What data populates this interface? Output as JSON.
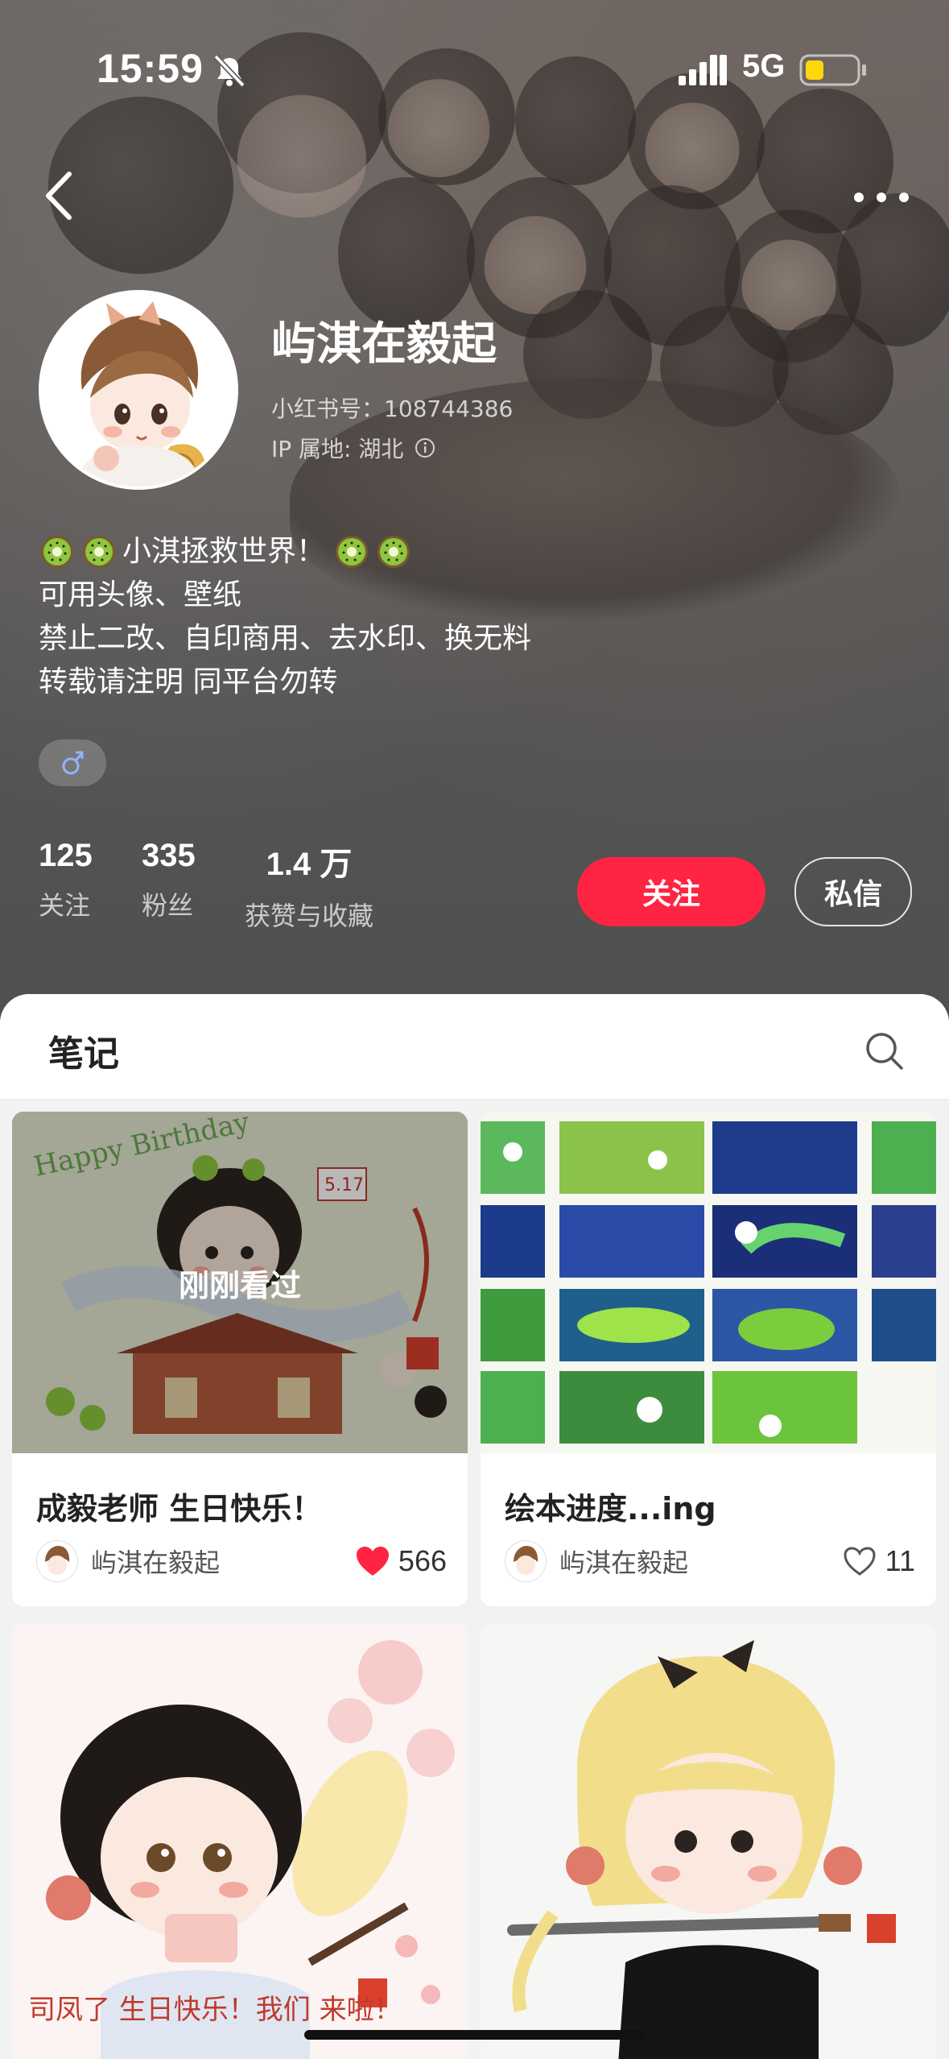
{
  "status_bar": {
    "time": "15:59",
    "network": "5G"
  },
  "profile": {
    "username": "屿淇在毅起",
    "user_id": "小红书号：108744386",
    "ip_location": "IP 属地: 湖北",
    "bio": [
      {
        "prefix_icons": 2,
        "text": "小淇拯救世界！",
        "suffix_icons": 2
      },
      {
        "prefix_icons": 0,
        "text": "可用头像、壁纸",
        "suffix_icons": 0
      },
      {
        "prefix_icons": 0,
        "text": "禁止二改、自印商用、去水印、换无料",
        "suffix_icons": 0
      },
      {
        "prefix_icons": 0,
        "text": "转载请注明 同平台勿转",
        "suffix_icons": 0
      }
    ],
    "gender_icon": "male-icon",
    "stats": [
      {
        "num": "125",
        "label": "关注"
      },
      {
        "num": "335",
        "label": "粉丝"
      },
      {
        "num": "1.4 万",
        "label": "获赞与收藏"
      }
    ],
    "follow_label": "关注",
    "message_label": "私信"
  },
  "notes": {
    "tab_label": "笔记",
    "cards": [
      {
        "title": "成毅老师 生日快乐！",
        "author": "屿淇在毅起",
        "likes": "566",
        "liked": true,
        "badge": "刚刚看过"
      },
      {
        "title": "绘本进度...ing",
        "author": "屿淇在毅起",
        "likes": "11",
        "liked": false,
        "badge": ""
      },
      {
        "title": "",
        "author": "",
        "likes": "",
        "liked": false,
        "badge": ""
      },
      {
        "title": "",
        "author": "",
        "likes": "",
        "liked": false,
        "badge": ""
      }
    ],
    "illustration_text": {
      "card1_lettering": "Happy Birthday",
      "card1_date": "5.17",
      "card3_lettering": "司凤了 生日快乐！我们 来啦！"
    }
  },
  "colors": {
    "accent": "#ff2442",
    "liked_heart": "#ff2442"
  }
}
